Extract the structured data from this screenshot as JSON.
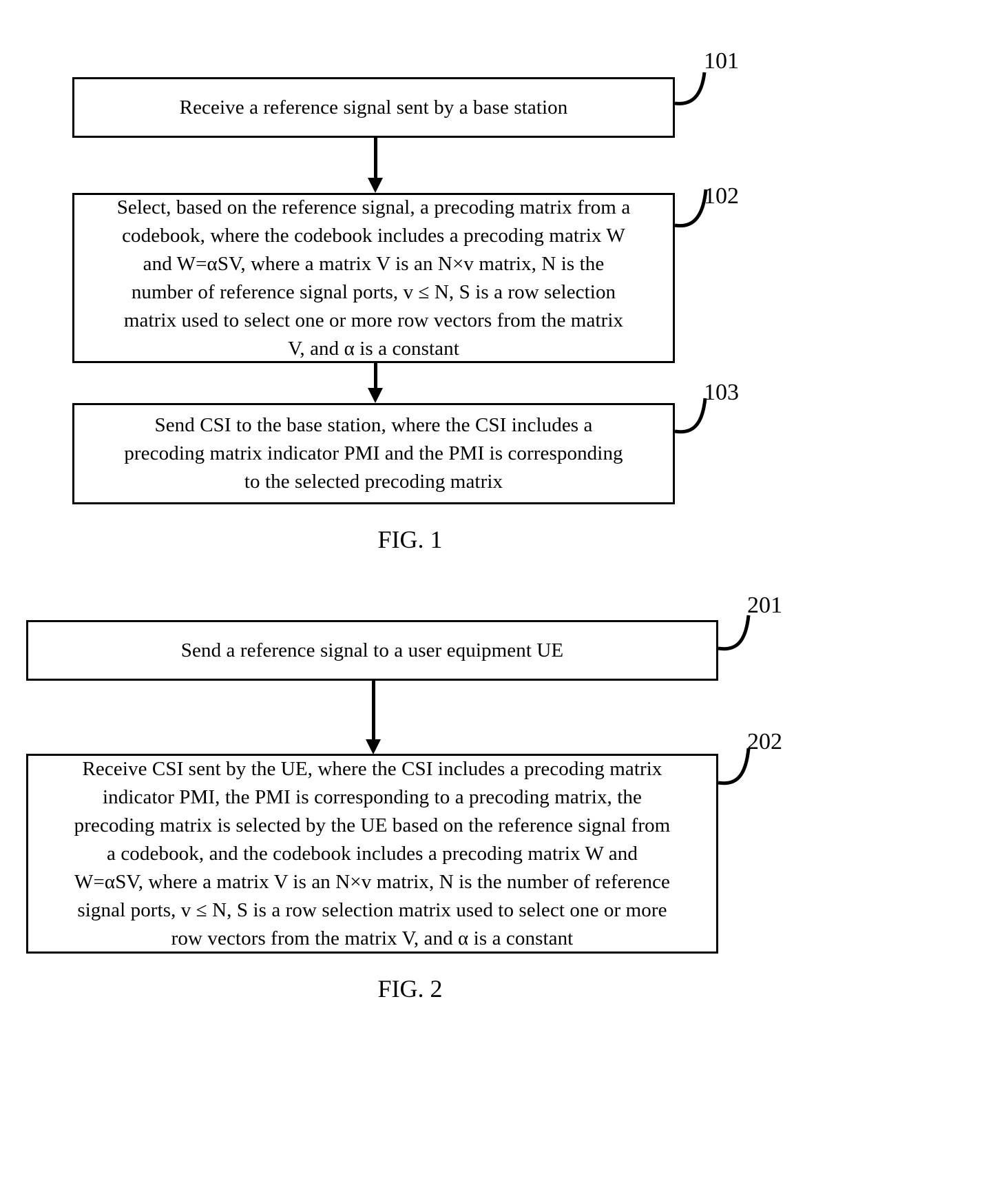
{
  "document": {
    "type": "patent-flowchart-sheet",
    "background_color": "#ffffff",
    "line_color": "#000000"
  },
  "figures": [
    {
      "id": "fig1",
      "caption": "FIG. 1",
      "steps": [
        {
          "ref": "101",
          "text": "Receive a reference signal sent by a base station"
        },
        {
          "ref": "102",
          "text": "Select, based on the reference signal, a precoding matrix from a\ncodebook, where the codebook includes a precoding matrix W\nand W=αSV, where a matrix V is an N×v matrix, N is the\nnumber of reference signal ports, v ≤ N, S is a row selection\nmatrix used to select one or more row vectors from the matrix\nV, and α is a constant"
        },
        {
          "ref": "103",
          "text": "Send CSI to the base station, where the CSI includes a\nprecoding matrix indicator PMI and the PMI is corresponding\nto the selected precoding matrix"
        }
      ]
    },
    {
      "id": "fig2",
      "caption": "FIG. 2",
      "steps": [
        {
          "ref": "201",
          "text": "Send a reference signal to a user equipment UE"
        },
        {
          "ref": "202",
          "text": "Receive CSI sent by the UE, where the CSI includes a precoding matrix\nindicator PMI, the PMI is corresponding to a precoding matrix, the\nprecoding matrix is selected by the UE based on the reference signal from\na codebook, and the codebook includes a precoding matrix W and\nW=αSV, where a matrix V is an N×v matrix, N is the number of reference\nsignal ports, v ≤ N, S is a row selection matrix used to select one or more\nrow vectors from the matrix V, and α is a constant"
        }
      ]
    }
  ]
}
